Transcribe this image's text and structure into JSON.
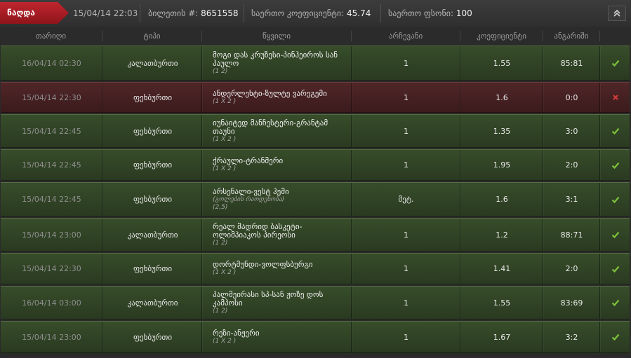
{
  "topbar": {
    "active_tab": "ნაღდა",
    "date": "15/04/14 22:03",
    "ticket_label": "ბილეთის #:",
    "ticket_value": "8651558",
    "total_coef_label": "საერთო კოეფიციენტი:",
    "total_coef_value": "45.74",
    "total_sum_label": "საერთო ფსონი:",
    "total_sum_value": "100"
  },
  "columns": [
    "თარიღი",
    "ტიპი",
    "წყვილი",
    "არჩევანი",
    "კოეფიციენტი",
    "ანგარიში"
  ],
  "rows": [
    {
      "date": "16/04/14 02:30",
      "type": "კალათბურთი",
      "event": "მოგი დას კრუზესი-პინჰეიროს სან პაულო",
      "sub": "(1 2)",
      "choice": "1",
      "coef": "1.55",
      "score": "85:81",
      "result": "won"
    },
    {
      "date": "15/04/14 22:30",
      "type": "ფეხბურთი",
      "event": "ანდერლეხტი-ზულტე ვარეგემი",
      "sub": "(1 X 2 )",
      "choice": "1",
      "coef": "1.6",
      "score": "0:0",
      "result": "lost"
    },
    {
      "date": "15/04/14 22:45",
      "type": "ფეხბურთი",
      "event": "იუნაიტედ მანჩესტერი-გრანტამ თაუნი",
      "sub": "(1 X 2 )",
      "choice": "1",
      "coef": "1.35",
      "score": "3:0",
      "result": "won"
    },
    {
      "date": "15/04/14 22:45",
      "type": "ფეხბურთი",
      "event": "ქრაული-ტრანმერი",
      "sub": "(1 X 2 )",
      "choice": "1",
      "coef": "1.95",
      "score": "2:0",
      "result": "won"
    },
    {
      "date": "15/04/14 22:45",
      "type": "ფეხბურთი",
      "event": "არსენალი-ვესტ ჰემი",
      "sub": "(გოლების რაოდენობა)\n(2,5)",
      "choice": "მეტ.",
      "coef": "1.6",
      "score": "3:1",
      "result": "won"
    },
    {
      "date": "15/04/14 23:00",
      "type": "კალათბურთი",
      "event": "რეალ მადრიდ ბასკეტი-ოლიმპიაკოს პირეოსი",
      "sub": "(1 2)",
      "choice": "1",
      "coef": "1.2",
      "score": "88:71",
      "result": "won"
    },
    {
      "date": "15/04/14 22:30",
      "type": "ფეხბურთი",
      "event": "დორტმუნდი-ვოლფსბურგი",
      "sub": "(1 X 2 )",
      "choice": "1",
      "coef": "1.41",
      "score": "2:0",
      "result": "won"
    },
    {
      "date": "16/04/14 03:00",
      "type": "კალათბურთი",
      "event": "პალმეირასი სპ-სან ჟოზე დოს კამპოსი",
      "sub": "(1 2)",
      "choice": "1",
      "coef": "1.55",
      "score": "83:69",
      "result": "won"
    },
    {
      "date": "15/04/14 23:00",
      "type": "ფეხბურთი",
      "event": "რეზი-ანჟერი",
      "sub": "(1 X 2 )",
      "choice": "1",
      "coef": "1.67",
      "score": "3:2",
      "result": "won"
    }
  ],
  "colors": {
    "won": "#7ec23a",
    "lost": "#d23b3b",
    "accent": "#b01e25"
  },
  "icons": {
    "won": "check-icon",
    "lost": "cross-icon",
    "collapse": "chevron-up-icon"
  }
}
